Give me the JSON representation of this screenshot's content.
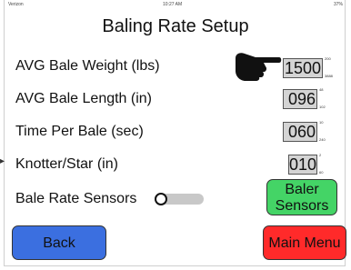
{
  "status": {
    "left": "Verizon",
    "center": "10:27 AM",
    "right": "37%"
  },
  "title": "Baling Rate Setup",
  "rows": [
    {
      "label": "AVG Bale Weight (lbs)",
      "value": "1500",
      "max": "200",
      "min": "3888"
    },
    {
      "label": "AVG Bale Length (in)",
      "value": "096",
      "max": "48",
      "min": "102"
    },
    {
      "label": "Time Per Bale (sec)",
      "value": "060",
      "max": "10",
      "min": "240"
    },
    {
      "label": "Knotter/Star (in)",
      "value": "010",
      "max": "2",
      "min": "60"
    }
  ],
  "sensors_toggle": {
    "label": "Bale Rate Sensors",
    "on": false
  },
  "buttons": {
    "baler_sensors": [
      "Baler",
      "Sensors"
    ],
    "back": "Back",
    "main_menu": "Main Menu"
  },
  "colors": {
    "green": "#44d466",
    "blue": "#3b6fe0",
    "red": "#ff2a2a",
    "field_bg": "#d4d4d4"
  },
  "icons": {
    "pointer": "pointing-hand-icon"
  }
}
